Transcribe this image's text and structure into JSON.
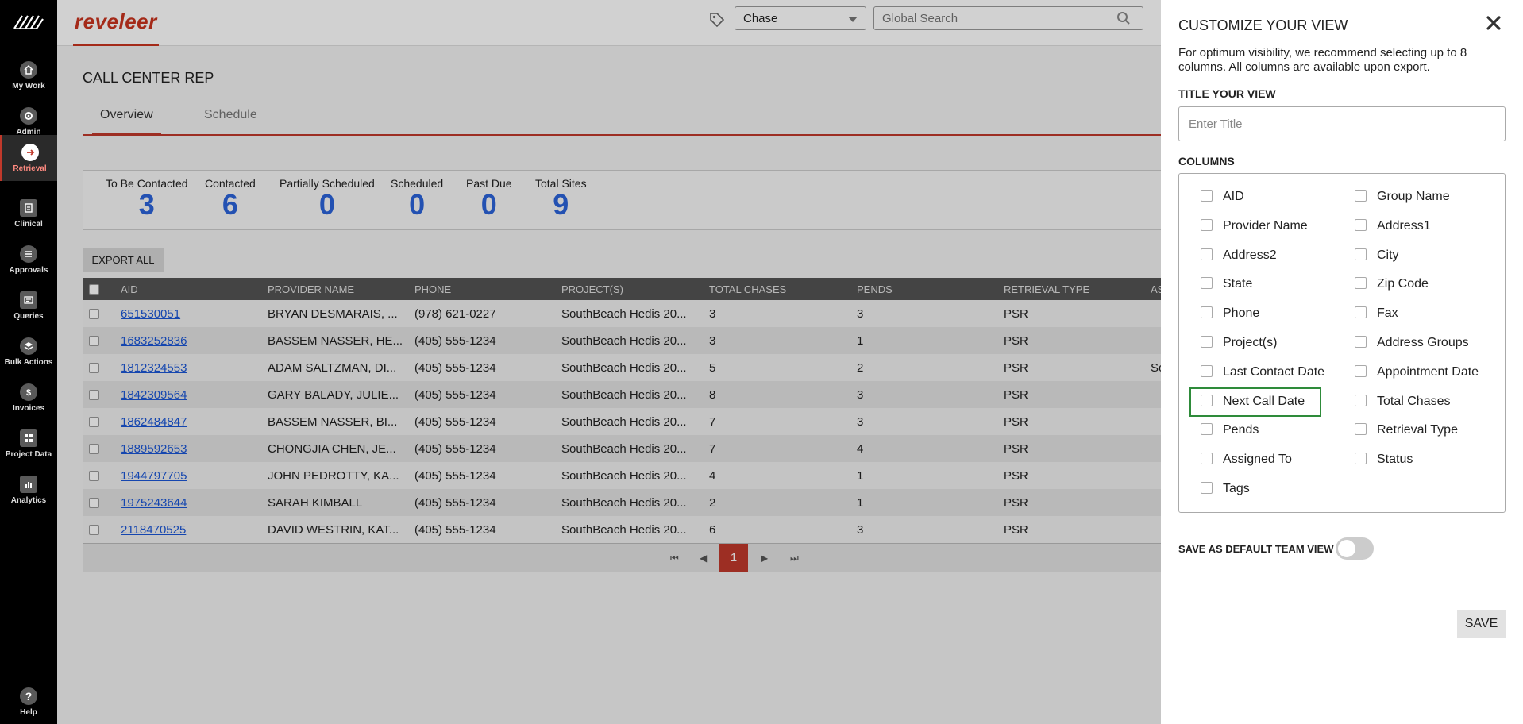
{
  "nav": {
    "items": [
      {
        "label": "My Work",
        "icon": "home-icon"
      },
      {
        "label": "Admin",
        "icon": "gear-icon"
      },
      {
        "label": "Retrieval",
        "icon": "arrow-right-icon"
      },
      {
        "label": "Clinical",
        "icon": "clipboard-icon"
      },
      {
        "label": "Approvals",
        "icon": "list-icon"
      },
      {
        "label": "Queries",
        "icon": "document-icon"
      },
      {
        "label": "Bulk Actions",
        "icon": "layers-icon"
      },
      {
        "label": "Invoices",
        "icon": "dollar-icon"
      },
      {
        "label": "Project Data",
        "icon": "grid-icon"
      },
      {
        "label": "Analytics",
        "icon": "bar-chart-icon"
      }
    ],
    "help": "Help",
    "help_icon": "?"
  },
  "header": {
    "brand": "reveleer",
    "select_value": "Chase",
    "search_placeholder": "Global Search"
  },
  "page": {
    "title": "CALL CENTER REP",
    "tabs": [
      "Overview",
      "Schedule"
    ]
  },
  "stats": [
    {
      "label": "To Be Contacted",
      "value": "3"
    },
    {
      "label": "Contacted",
      "value": "6"
    },
    {
      "label": "Partially Scheduled",
      "value": "0"
    },
    {
      "label": "Scheduled",
      "value": "0"
    },
    {
      "label": "Past Due",
      "value": "0"
    },
    {
      "label": "Total Sites",
      "value": "9"
    }
  ],
  "export_label": "EXPORT ALL",
  "table": {
    "columns": [
      "AID",
      "PROVIDER NAME",
      "PHONE",
      "PROJECT(S)",
      "TOTAL CHASES",
      "PENDS",
      "RETRIEVAL TYPE",
      "AS"
    ],
    "rows": [
      [
        "651530051",
        "BRYAN DESMARAIS, ...",
        "(978) 621-0227",
        "SouthBeach Hedis 20...",
        "3",
        "3",
        "PSR",
        ""
      ],
      [
        "1683252836",
        "BASSEM NASSER, HE...",
        "(405) 555-1234",
        "SouthBeach Hedis 20...",
        "3",
        "1",
        "PSR",
        ""
      ],
      [
        "1812324553",
        "ADAM SALTZMAN, DI...",
        "(405) 555-1234",
        "SouthBeach Hedis 20...",
        "5",
        "2",
        "PSR",
        "So"
      ],
      [
        "1842309564",
        "GARY BALADY, JULIE...",
        "(405) 555-1234",
        "SouthBeach Hedis 20...",
        "8",
        "3",
        "PSR",
        ""
      ],
      [
        "1862484847",
        "BASSEM NASSER, BI...",
        "(405) 555-1234",
        "SouthBeach Hedis 20...",
        "7",
        "3",
        "PSR",
        ""
      ],
      [
        "1889592653",
        "CHONGJIA CHEN, JE...",
        "(405) 555-1234",
        "SouthBeach Hedis 20...",
        "7",
        "4",
        "PSR",
        ""
      ],
      [
        "1944797705",
        "JOHN PEDROTTY, KA...",
        "(405) 555-1234",
        "SouthBeach Hedis 20...",
        "4",
        "1",
        "PSR",
        ""
      ],
      [
        "1975243644",
        "SARAH KIMBALL",
        "(405) 555-1234",
        "SouthBeach Hedis 20...",
        "2",
        "1",
        "PSR",
        ""
      ],
      [
        "2118470525",
        "DAVID WESTRIN, KAT...",
        "(405) 555-1234",
        "SouthBeach Hedis 20...",
        "6",
        "3",
        "PSR",
        ""
      ]
    ],
    "pager": {
      "current": "1"
    }
  },
  "panel": {
    "title": "CUSTOMIZE YOUR VIEW",
    "description": "For optimum visibility, we recommend selecting up to 8 columns. All columns are available upon export.",
    "title_section": "TITLE YOUR VIEW",
    "title_placeholder": "Enter Title",
    "columns_section": "COLUMNS",
    "columns_left": [
      "AID",
      "Provider Name",
      "Address2",
      "State",
      "Phone",
      "Project(s)",
      "Last Contact Date",
      "Next Call Date",
      "Pends",
      "Assigned To",
      "Tags"
    ],
    "columns_right": [
      "Group Name",
      "Address1",
      "City",
      "Zip Code",
      "Fax",
      "Address Groups",
      "Appointment Date",
      "Total Chases",
      "Retrieval Type",
      "Status"
    ],
    "default_label": "SAVE AS DEFAULT TEAM VIEW",
    "default_on": false,
    "save_label": "SAVE"
  },
  "colors": {
    "brand": "#c8341f",
    "accent": "#c0392b",
    "stat_value": "#2b63d9",
    "link": "#1a56d6",
    "highlight": "#2e8b3a"
  }
}
